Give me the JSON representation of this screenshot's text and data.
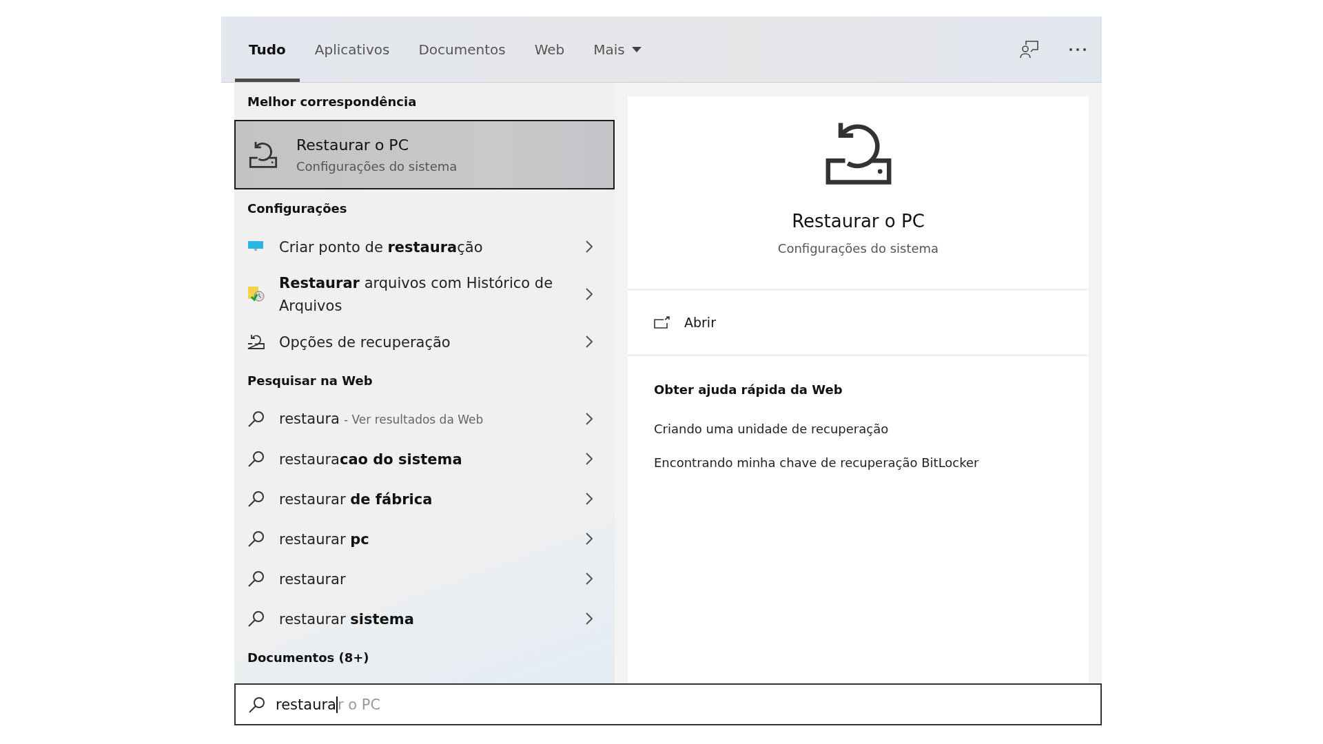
{
  "tabs": [
    {
      "label": "Tudo",
      "selected": true
    },
    {
      "label": "Aplicativos",
      "selected": false
    },
    {
      "label": "Documentos",
      "selected": false
    },
    {
      "label": "Web",
      "selected": false
    },
    {
      "label": "Mais",
      "selected": false,
      "dropdown": true
    }
  ],
  "results": {
    "best_match": {
      "header": "Melhor correspondência",
      "title": "Restaurar o PC",
      "subtitle": "Configurações do sistema",
      "selected": true
    },
    "sections": [
      {
        "header": "Configurações",
        "items": [
          {
            "kind": "monitor",
            "text": "Criar ponto de **restaura**ção"
          },
          {
            "kind": "file-history",
            "text": "**Restaurar** arquivos com Histórico de Arquivos"
          },
          {
            "kind": "recovery",
            "text": "Opções de recuperação"
          }
        ]
      },
      {
        "header": "Pesquisar na Web",
        "items": [
          {
            "kind": "search",
            "text": "restaura",
            "hint": "- Ver resultados da Web"
          },
          {
            "kind": "search",
            "text": "restaura**cao do sistema**"
          },
          {
            "kind": "search",
            "text": "restaurar **de fábrica**"
          },
          {
            "kind": "search",
            "text": "restaurar **pc**"
          },
          {
            "kind": "search",
            "text": "restaurar"
          },
          {
            "kind": "search",
            "text": "restaurar **sistema**"
          }
        ]
      },
      {
        "header": "Documentos (8+)"
      }
    ]
  },
  "preview": {
    "title": "Restaurar o PC",
    "subtitle": "Configurações do sistema",
    "action": "Abrir",
    "help_header": "Obter ajuda rápida da Web",
    "help_links": [
      "Criando uma unidade de recuperação",
      "Encontrando minha chave de recuperação BitLocker"
    ]
  },
  "search": {
    "value": "restaura",
    "completion": "r o PC"
  }
}
